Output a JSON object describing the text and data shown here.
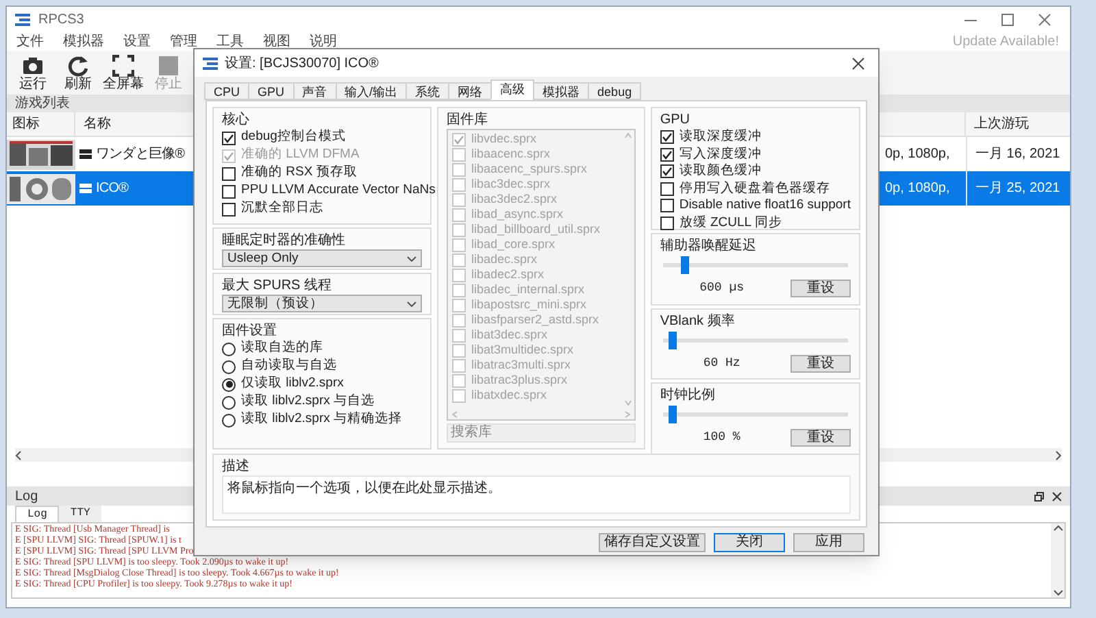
{
  "window": {
    "title": "RPCS3",
    "update_notice": "Update Available!"
  },
  "menu": [
    "文件",
    "模拟器",
    "设置",
    "管理",
    "工具",
    "视图",
    "说明"
  ],
  "toolbar": [
    {
      "label": "运行",
      "kind": "play",
      "disabled": false
    },
    {
      "label": "刷新",
      "kind": "refresh",
      "disabled": false
    },
    {
      "label": "全屏幕",
      "kind": "fullscreen",
      "disabled": false
    },
    {
      "label": "停止",
      "kind": "stop",
      "disabled": true
    }
  ],
  "game_list": {
    "title": "游戏列表",
    "columns": [
      "图标",
      "名称",
      "上次游玩"
    ],
    "rows": [
      {
        "name": "ワンダと巨像®",
        "column_3": "0p, 1080p,",
        "last_played": "一月 16, 2021",
        "selected": false
      },
      {
        "name": "ICO®",
        "column_3": "0p, 1080p,",
        "last_played": "一月 25, 2021",
        "selected": true
      }
    ]
  },
  "log": {
    "title": "Log",
    "tabs": [
      {
        "label": "Log",
        "selected": true
      },
      {
        "label": "TTY",
        "selected": false
      }
    ],
    "lines": [
      "E SIG: Thread [Usb Manager Thread] is",
      "E [SPU LLVM] SIG: Thread [SPUW.1] is t",
      "E [SPU LLVM] SIG: Thread [SPU LLVM Pro",
      "E SIG: Thread [SPU LLVM] is too sleepy. Took 2.090µs to wake it up!",
      "E SIG: Thread [MsgDialog Close Thread] is too sleepy. Took 4.667µs to wake it up!",
      "E SIG: Thread [CPU Profiler] is too sleepy. Took 9.278µs to wake it up!"
    ]
  },
  "dialog": {
    "title": "设置: [BCJS30070] ICO®",
    "tabs": [
      {
        "label": "CPU",
        "selected": false
      },
      {
        "label": "GPU",
        "selected": false
      },
      {
        "label": "声音",
        "selected": false
      },
      {
        "label": "输入/输出",
        "selected": false
      },
      {
        "label": "系统",
        "selected": false
      },
      {
        "label": "网络",
        "selected": false
      },
      {
        "label": "高级",
        "selected": true
      },
      {
        "label": "模拟器",
        "selected": false
      },
      {
        "label": "debug",
        "selected": false
      }
    ],
    "core": {
      "title": "核心",
      "options": [
        {
          "label": "debug控制台模式",
          "checked": true,
          "disabled": false
        },
        {
          "label": "准确的 LLVM DFMA",
          "checked": true,
          "disabled": true
        },
        {
          "label": "准确的 RSX 预存取",
          "checked": false,
          "disabled": false
        },
        {
          "label": "PPU LLVM Accurate Vector NaNs",
          "checked": false,
          "disabled": false
        },
        {
          "label": "沉默全部日志",
          "checked": false,
          "disabled": false
        }
      ]
    },
    "sleep_timer": {
      "title": "睡眠定时器的准确性",
      "value": "Usleep Only"
    },
    "spurs": {
      "title": "最大 SPURS 线程",
      "value": "无限制（预设）"
    },
    "firmware": {
      "title": "固件设置",
      "options": [
        {
          "label": "读取自选的库",
          "selected": false
        },
        {
          "label": "自动读取与自选",
          "selected": false
        },
        {
          "label": "仅读取 liblv2.sprx",
          "selected": true
        },
        {
          "label": "读取 liblv2.sprx 与自选",
          "selected": false
        },
        {
          "label": "读取 liblv2.sprx 与精确选择",
          "selected": false
        }
      ]
    },
    "libraries": {
      "title": "固件库",
      "disabled": true,
      "placeholder": "搜索库",
      "items": [
        {
          "label": "libvdec.sprx",
          "checked": true
        },
        {
          "label": "libaacenc.sprx",
          "checked": false
        },
        {
          "label": "libaacenc_spurs.sprx",
          "checked": false
        },
        {
          "label": "libac3dec.sprx",
          "checked": false
        },
        {
          "label": "libac3dec2.sprx",
          "checked": false
        },
        {
          "label": "libad_async.sprx",
          "checked": false
        },
        {
          "label": "libad_billboard_util.sprx",
          "checked": false
        },
        {
          "label": "libad_core.sprx",
          "checked": false
        },
        {
          "label": "libadec.sprx",
          "checked": false
        },
        {
          "label": "libadec2.sprx",
          "checked": false
        },
        {
          "label": "libadec_internal.sprx",
          "checked": false
        },
        {
          "label": "libapostsrc_mini.sprx",
          "checked": false
        },
        {
          "label": "libasfparser2_astd.sprx",
          "checked": false
        },
        {
          "label": "libat3dec.sprx",
          "checked": false
        },
        {
          "label": "libat3multidec.sprx",
          "checked": false
        },
        {
          "label": "libatrac3multi.sprx",
          "checked": false
        },
        {
          "label": "libatrac3plus.sprx",
          "checked": false
        },
        {
          "label": "libatxdec.sprx",
          "checked": false
        }
      ]
    },
    "gpu": {
      "title": "GPU",
      "options": [
        {
          "label": "读取深度缓冲",
          "checked": true
        },
        {
          "label": "写入深度缓冲",
          "checked": true
        },
        {
          "label": "读取颜色缓冲",
          "checked": true
        },
        {
          "label": "停用写入硬盘着色器缓存",
          "checked": false
        },
        {
          "label": "Disable native float16 support",
          "checked": false
        },
        {
          "label": "放缓 ZCULL 同步",
          "checked": false
        }
      ]
    },
    "sliders": [
      {
        "title": "辅助器唤醒延迟",
        "level": 0.1,
        "reading": "600 µs",
        "reset": "重设"
      },
      {
        "title": "VBlank 频率",
        "level": 0.03,
        "reading": "60 Hz",
        "reset": "重设"
      },
      {
        "title": "时钟比例",
        "level": 0.03,
        "reading": "100 %",
        "reset": "重设"
      }
    ],
    "description": {
      "title": "描述",
      "text": "将鼠标指向一个选项，以便在此处显示描述。"
    },
    "buttons": [
      {
        "label": "储存自定义设置",
        "default": false
      },
      {
        "label": "关闭",
        "default": true
      },
      {
        "label": "应用",
        "default": false
      }
    ]
  }
}
